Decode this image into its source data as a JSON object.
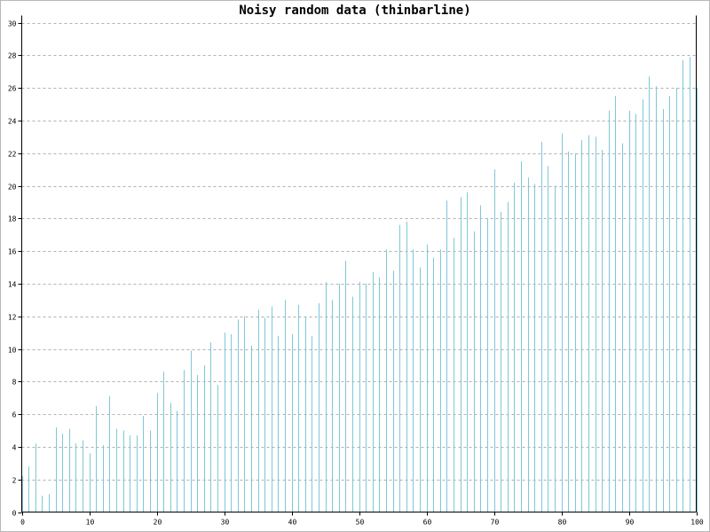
{
  "chart_data": {
    "type": "bar",
    "title": "Noisy random data (thinbarline)",
    "xlabel": "",
    "ylabel": "",
    "xlim": [
      0,
      100
    ],
    "ylim": [
      0,
      30
    ],
    "x_ticks": [
      0,
      10,
      20,
      30,
      40,
      50,
      60,
      70,
      80,
      90,
      100
    ],
    "y_ticks": [
      0,
      2,
      4,
      6,
      8,
      10,
      12,
      14,
      16,
      18,
      20,
      22,
      24,
      26,
      28,
      30
    ],
    "grid": "horizontal dashed",
    "bar_color": "#7ec8d8",
    "x": [
      0,
      1,
      2,
      3,
      4,
      5,
      6,
      7,
      8,
      9,
      10,
      11,
      12,
      13,
      14,
      15,
      16,
      17,
      18,
      19,
      20,
      21,
      22,
      23,
      24,
      25,
      26,
      27,
      28,
      29,
      30,
      31,
      32,
      33,
      34,
      35,
      36,
      37,
      38,
      39,
      40,
      41,
      42,
      43,
      44,
      45,
      46,
      47,
      48,
      49,
      50,
      51,
      52,
      53,
      54,
      55,
      56,
      57,
      58,
      59,
      60,
      61,
      62,
      63,
      64,
      65,
      66,
      67,
      68,
      69,
      70,
      71,
      72,
      73,
      74,
      75,
      76,
      77,
      78,
      79,
      80,
      81,
      82,
      83,
      84,
      85,
      86,
      87,
      88,
      89,
      90,
      91,
      92,
      93,
      94,
      95,
      96,
      97,
      98,
      99,
      100
    ],
    "values": [
      2.2,
      2.8,
      4.2,
      1.0,
      1.1,
      5.2,
      4.8,
      5.1,
      4.2,
      4.4,
      3.6,
      6.5,
      4.1,
      7.1,
      5.1,
      5.0,
      4.7,
      4.7,
      5.9,
      5.0,
      7.3,
      8.6,
      6.7,
      6.2,
      8.7,
      9.9,
      8.4,
      9.0,
      10.4,
      7.8,
      11.0,
      10.9,
      11.8,
      12.0,
      10.2,
      12.4,
      11.9,
      12.6,
      10.8,
      13.0,
      10.9,
      12.7,
      12.0,
      10.8,
      12.8,
      14.1,
      13.0,
      14.0,
      15.4,
      13.2,
      14.1,
      14.0,
      14.7,
      14.4,
      16.1,
      14.8,
      17.6,
      17.8,
      16.1,
      15.0,
      16.4,
      15.6,
      16.1,
      19.1,
      16.8,
      19.3,
      19.6,
      17.2,
      18.8,
      18.0,
      21.0,
      18.4,
      19.0,
      20.2,
      21.5,
      20.5,
      20.1,
      22.7,
      21.2,
      20.0,
      23.2,
      22.1,
      22.0,
      22.8,
      23.1,
      23.0,
      22.2,
      24.6,
      25.5,
      22.6,
      24.6,
      24.4,
      25.3,
      26.7,
      26.1,
      24.7,
      25.5,
      26.0,
      27.7,
      27.9,
      26.0
    ]
  }
}
